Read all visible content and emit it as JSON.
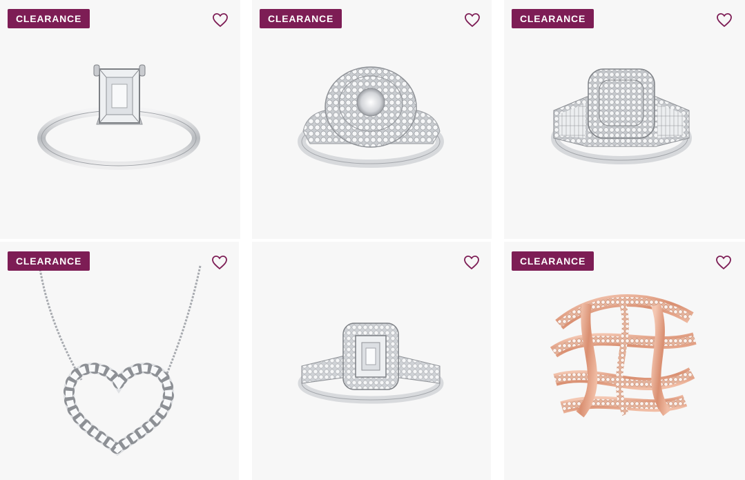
{
  "products": [
    {
      "badge": "CLEARANCE",
      "image": "emerald-cut-solitaire-ring",
      "icon": "heart-icon"
    },
    {
      "badge": "CLEARANCE",
      "image": "round-halo-cluster-ring",
      "icon": "heart-icon"
    },
    {
      "badge": "CLEARANCE",
      "image": "cushion-cluster-ring",
      "icon": "heart-icon"
    },
    {
      "badge": "CLEARANCE",
      "image": "diamond-heart-necklace",
      "icon": "heart-icon"
    },
    {
      "badge": "",
      "image": "emerald-cut-halo-ring",
      "icon": "heart-icon"
    },
    {
      "badge": "CLEARANCE",
      "image": "rose-gold-crossover-ring",
      "icon": "heart-icon"
    }
  ],
  "colors": {
    "badge_bg": "#7d1d55",
    "badge_text": "#ffffff",
    "heart_stroke": "#7d1d55",
    "card_bg": "#f7f7f7",
    "metal_silver": "#d9dadc",
    "metal_rose": "#e3a488"
  }
}
